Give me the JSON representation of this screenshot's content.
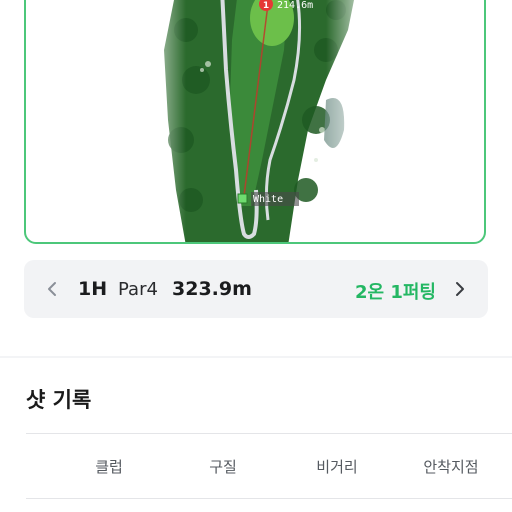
{
  "map": {
    "shot_marker_number": "1",
    "shot_distance": "214.6m",
    "tee_label": "White",
    "colors": {
      "fairway": "#3b8a3a",
      "rough": "#2b6a2d",
      "green": "#6cbf4a",
      "path": "#d8dde0",
      "shot_line": "#c0392b",
      "marker": "#e53935",
      "tee_marker": "#6fdc6f"
    }
  },
  "hole_bar": {
    "hole": "1H",
    "par": "Par4",
    "distance": "323.9m",
    "score": "2온 1퍼팅",
    "prev_icon": "chevron-left-icon",
    "next_icon": "chevron-right-icon",
    "score_color": "#24b763"
  },
  "shot_record": {
    "title": "샷 기록",
    "columns": [
      "클럽",
      "구질",
      "비거리",
      "안착지점"
    ]
  }
}
